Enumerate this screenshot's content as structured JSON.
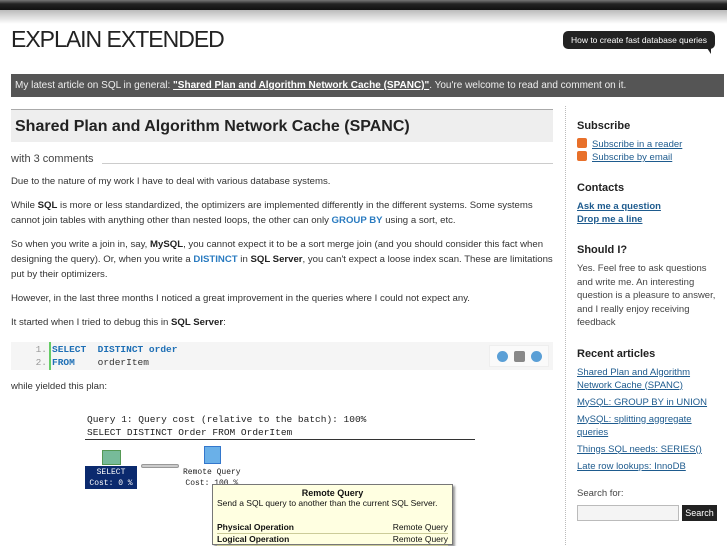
{
  "site": {
    "title": "EXPLAIN EXTENDED",
    "tagline": "How to create fast database queries"
  },
  "banner": {
    "prefix": "My latest article on SQL in general: ",
    "link": "\"Shared Plan and Algorithm Network Cache (SPANC)\"",
    "suffix": ". You're welcome to read and comment on it."
  },
  "post": {
    "title": "Shared Plan and Algorithm Network Cache (SPANC)",
    "comments": "with 3 comments",
    "p1": "Due to the nature of my work I have to deal with various database systems.",
    "p2": [
      "While ",
      "SQL",
      " is more or less standardized, the optimizers are implemented differently in the different systems. Some systems cannot join tables with anything other than nested loops, the other can only ",
      "GROUP BY",
      " using a sort, etc."
    ],
    "p3": [
      "So when you write a join in, say, ",
      "MySQL",
      ", you cannot expect it to be a sort merge join (and you should consider this fact when designing the query). Or, when you write a ",
      "DISTINCT",
      " in ",
      "SQL Server",
      ", you can't expect a loose index scan. These are limitations put by their optimizers."
    ],
    "p4": "However, in the last three months I noticed a great improvement in the queries where I could not expect any.",
    "p5": [
      "It started when I tried to debug this in ",
      "SQL Server",
      ":"
    ],
    "code": {
      "lines": [
        {
          "n": "1.",
          "kw": "SELECT",
          "rest": "DISTINCT order",
          "rest_kw": true
        },
        {
          "n": "2.",
          "kw": "FROM",
          "rest": "orderItem",
          "rest_kw": false
        }
      ]
    },
    "p6": "while yielded this plan:",
    "plan": {
      "header1": "Query 1: Query cost (relative to the batch): 100%",
      "header2": "SELECT DISTINCT Order FROM OrderItem",
      "select_label": "SELECT",
      "select_cost": "Cost: 0 %",
      "remote_label": "Remote Query",
      "remote_cost": "Cost: 100 %",
      "tooltip": {
        "title": "Remote Query",
        "desc": "Send a SQL query to another than the current SQL Server.",
        "rows": [
          {
            "k": "Physical Operation",
            "v": "Remote Query"
          },
          {
            "k": "Logical Operation",
            "v": "Remote Query"
          }
        ]
      }
    }
  },
  "sidebar": {
    "subscribe": {
      "title": "Subscribe",
      "reader": "Subscribe in a reader",
      "email": "Subscribe by email"
    },
    "contacts": {
      "title": "Contacts",
      "ask": "Ask me a question",
      "drop": "Drop me a line"
    },
    "should": {
      "title": "Should I?",
      "text": "Yes. Feel free to ask questions and write me. An interesting question is a pleasure to answer, and I really enjoy receiving feedback"
    },
    "recent": {
      "title": "Recent articles",
      "items": [
        "Shared Plan and Algorithm Network Cache (SPANC)",
        "MySQL: GROUP BY in UNION",
        "MySQL: splitting aggregate queries",
        "Things SQL needs: SERIES()",
        "Late row lookups: InnoDB"
      ]
    },
    "search": {
      "label": "Search for:",
      "value": "",
      "button": "Search"
    }
  }
}
